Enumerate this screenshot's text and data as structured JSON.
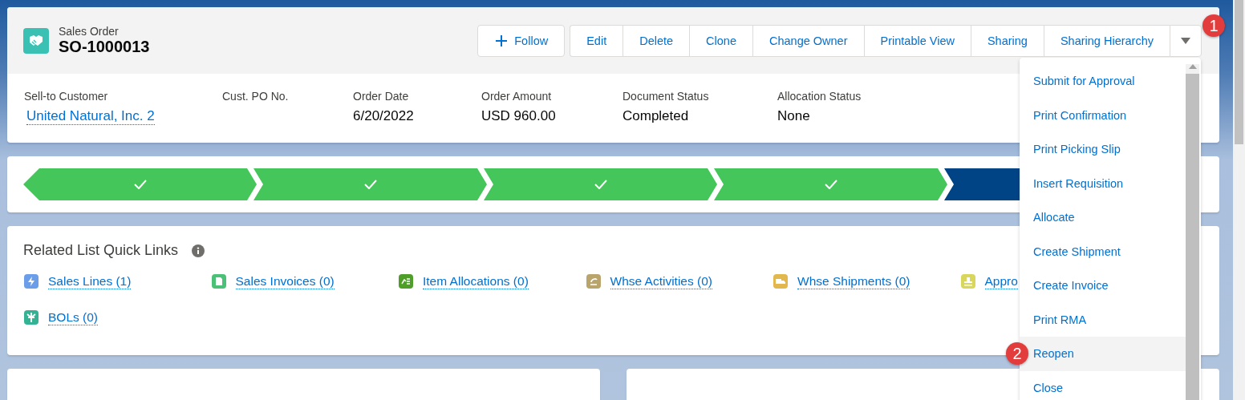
{
  "record": {
    "object_label": "Sales Order",
    "name": "SO-1000013"
  },
  "actions": {
    "follow": "Follow",
    "buttons": [
      "Edit",
      "Delete",
      "Clone",
      "Change Owner",
      "Printable View",
      "Sharing",
      "Sharing Hierarchy"
    ]
  },
  "fields": [
    {
      "label": "Sell-to Customer",
      "value": "United Natural, Inc. 2",
      "kind": "link"
    },
    {
      "label": "Cust. PO No."
    },
    {
      "label": "Order Date",
      "value": "6/20/2022",
      "kind": "text"
    },
    {
      "label": "Order Amount",
      "value": "USD 960.00",
      "kind": "text"
    },
    {
      "label": "Document Status",
      "value": "Completed",
      "kind": "text"
    },
    {
      "label": "Allocation Status",
      "value": "None",
      "kind": "text"
    }
  ],
  "path": [
    {
      "complete": true,
      "selected": false
    },
    {
      "complete": true,
      "selected": false
    },
    {
      "complete": true,
      "selected": false
    },
    {
      "complete": true,
      "selected": false
    },
    {
      "complete": false,
      "selected": true
    }
  ],
  "quick_links": {
    "title": "Related List Quick Links",
    "items": [
      {
        "label": "Sales Lines (1)",
        "color": "#6b9de8"
      },
      {
        "label": "Sales Invoices (0)",
        "color": "#4bc076"
      },
      {
        "label": "Item Allocations (0)",
        "color": "#4f9e2a"
      },
      {
        "label": "Whse Activities (0)",
        "color": "#b9a46c"
      },
      {
        "label": "Whse Shipments (0)",
        "color": "#e2b84e"
      },
      {
        "label": "Appro",
        "color": "#d8d65c"
      },
      {
        "label": "BOLs (0)",
        "color": "#34b394"
      }
    ]
  },
  "menu": [
    {
      "label": "Submit for Approval",
      "selected": false
    },
    {
      "label": "Print Confirmation",
      "selected": false
    },
    {
      "label": "Print Picking Slip",
      "selected": false
    },
    {
      "label": "Insert Requisition",
      "selected": false
    },
    {
      "label": "Allocate",
      "selected": false
    },
    {
      "label": "Create Shipment",
      "selected": false
    },
    {
      "label": "Create Invoice",
      "selected": false
    },
    {
      "label": "Print RMA",
      "selected": false
    },
    {
      "label": "Reopen",
      "selected": true
    },
    {
      "label": "Close",
      "selected": false
    }
  ],
  "annotations": [
    {
      "label": "1",
      "kind": "menu-arrow"
    },
    {
      "label": "2",
      "kind": "menu-item"
    }
  ]
}
